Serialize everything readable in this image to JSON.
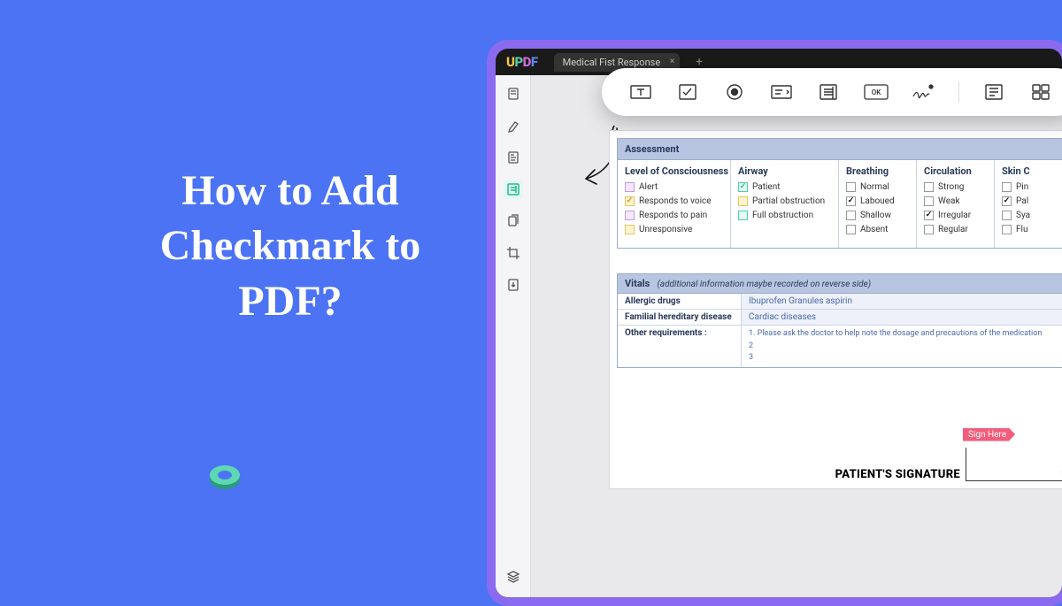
{
  "title": "How to Add Checkmark to PDF?",
  "logo": {
    "u": "U",
    "p": "P",
    "d": "D",
    "f": "F"
  },
  "tab": {
    "name": "Medical Fist Response",
    "add": "+"
  },
  "assessment": {
    "header": "Assessment",
    "cols": {
      "loc": {
        "title": "Level of Consciousness",
        "items": [
          "Alert",
          "Responds to voice",
          "Responds to pain",
          "Unresponsive"
        ]
      },
      "air": {
        "title": "Airway",
        "items": [
          "Patient",
          "Partial obstruction",
          "Full obstruction"
        ]
      },
      "bre": {
        "title": "Breathing",
        "items": [
          "Normal",
          "Laboued",
          "Shallow",
          "Absent"
        ]
      },
      "cir": {
        "title": "Circulation",
        "items": [
          "Strong",
          "Weak",
          "Irregular",
          "Regular"
        ]
      },
      "skin": {
        "title": "Skin C",
        "items": [
          "Pin",
          "Pal",
          "Sya",
          "Flu"
        ]
      }
    }
  },
  "vitals": {
    "header_bold": "Vitals",
    "header_em": "(additional information maybe recorded on reverse side)",
    "allergic_label": "Allergic drugs",
    "allergic_value": "Ibuprofen Granules  aspirin",
    "familial_label": "Familial hereditary disease",
    "familial_value": "Cardiac diseases",
    "other_label": "Other requirements :",
    "other_line1": "1. Please ask the doctor to help note the dosage and precautions of the medication",
    "other_line2": "2",
    "other_line3": "3"
  },
  "signature": {
    "label": "PATIENT'S SIGNATURE",
    "sign_here": "Sign Here"
  }
}
